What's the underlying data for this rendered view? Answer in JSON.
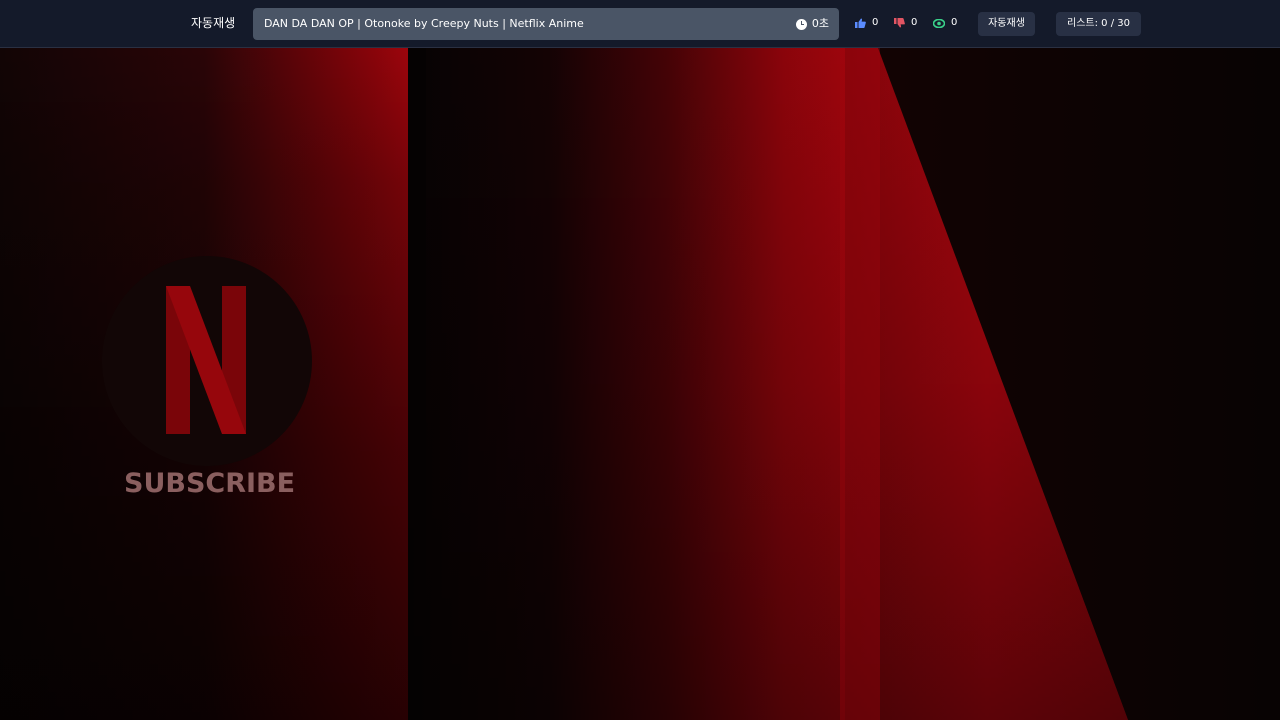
{
  "header": {
    "autoplay_label": "자동재생",
    "video_title": "DAN DA DAN OP | Otonoke by Creepy Nuts | Netflix Anime",
    "elapsed": "0초",
    "likes": "0",
    "dislikes": "0",
    "views": "0",
    "autoplay_button": "자동재생",
    "list_counter": "리스트: 0 / 30"
  },
  "video": {
    "subscribe_text": "SUBSCRIBE"
  },
  "icons": {
    "clock": "clock-icon",
    "like": "thumbs-up-icon",
    "dislike": "thumbs-down-icon",
    "views": "eye-icon",
    "logo": "netflix-n-logo"
  },
  "colors": {
    "like": "#5b8cff",
    "dislike": "#e25563",
    "views": "#3ad18a",
    "netflix_red": "#b00710"
  }
}
